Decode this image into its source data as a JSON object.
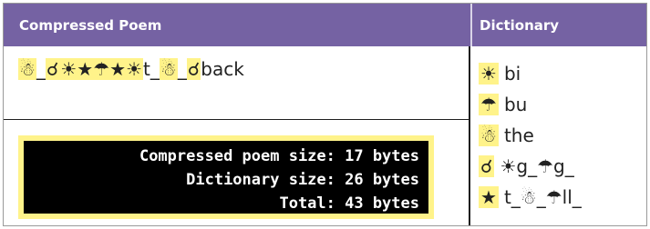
{
  "header": {
    "poem_title": "Compressed Poem",
    "dictionary_title": "Dictionary"
  },
  "poem": {
    "tokens": [
      {
        "text": "☃",
        "highlight": true
      },
      {
        "text": "_",
        "highlight": false
      },
      {
        "text": "☌",
        "highlight": true
      },
      {
        "text": "☀★☂★☀",
        "highlight": true
      },
      {
        "text": "t_",
        "highlight": false
      },
      {
        "text": "☃",
        "highlight": true
      },
      {
        "text": "_",
        "highlight": false
      },
      {
        "text": "☌",
        "highlight": true
      },
      {
        "text": "back",
        "highlight": false
      }
    ]
  },
  "stats": {
    "line1": "Compressed poem size: 17 bytes",
    "line2": "Dictionary size: 26 bytes",
    "line3": "Total: 43 bytes"
  },
  "dictionary": [
    {
      "symbol": "☀",
      "definition": "bi"
    },
    {
      "symbol": "☂",
      "definition": "bu"
    },
    {
      "symbol": "☃",
      "definition": "the"
    },
    {
      "symbol": "☌",
      "definition": "☀g_☂g_"
    },
    {
      "symbol": "★",
      "definition": "t_☃_☂ll_"
    }
  ],
  "colors": {
    "header_bg": "#7562a3",
    "highlight": "#fff38a",
    "terminal_bg": "#000000"
  }
}
